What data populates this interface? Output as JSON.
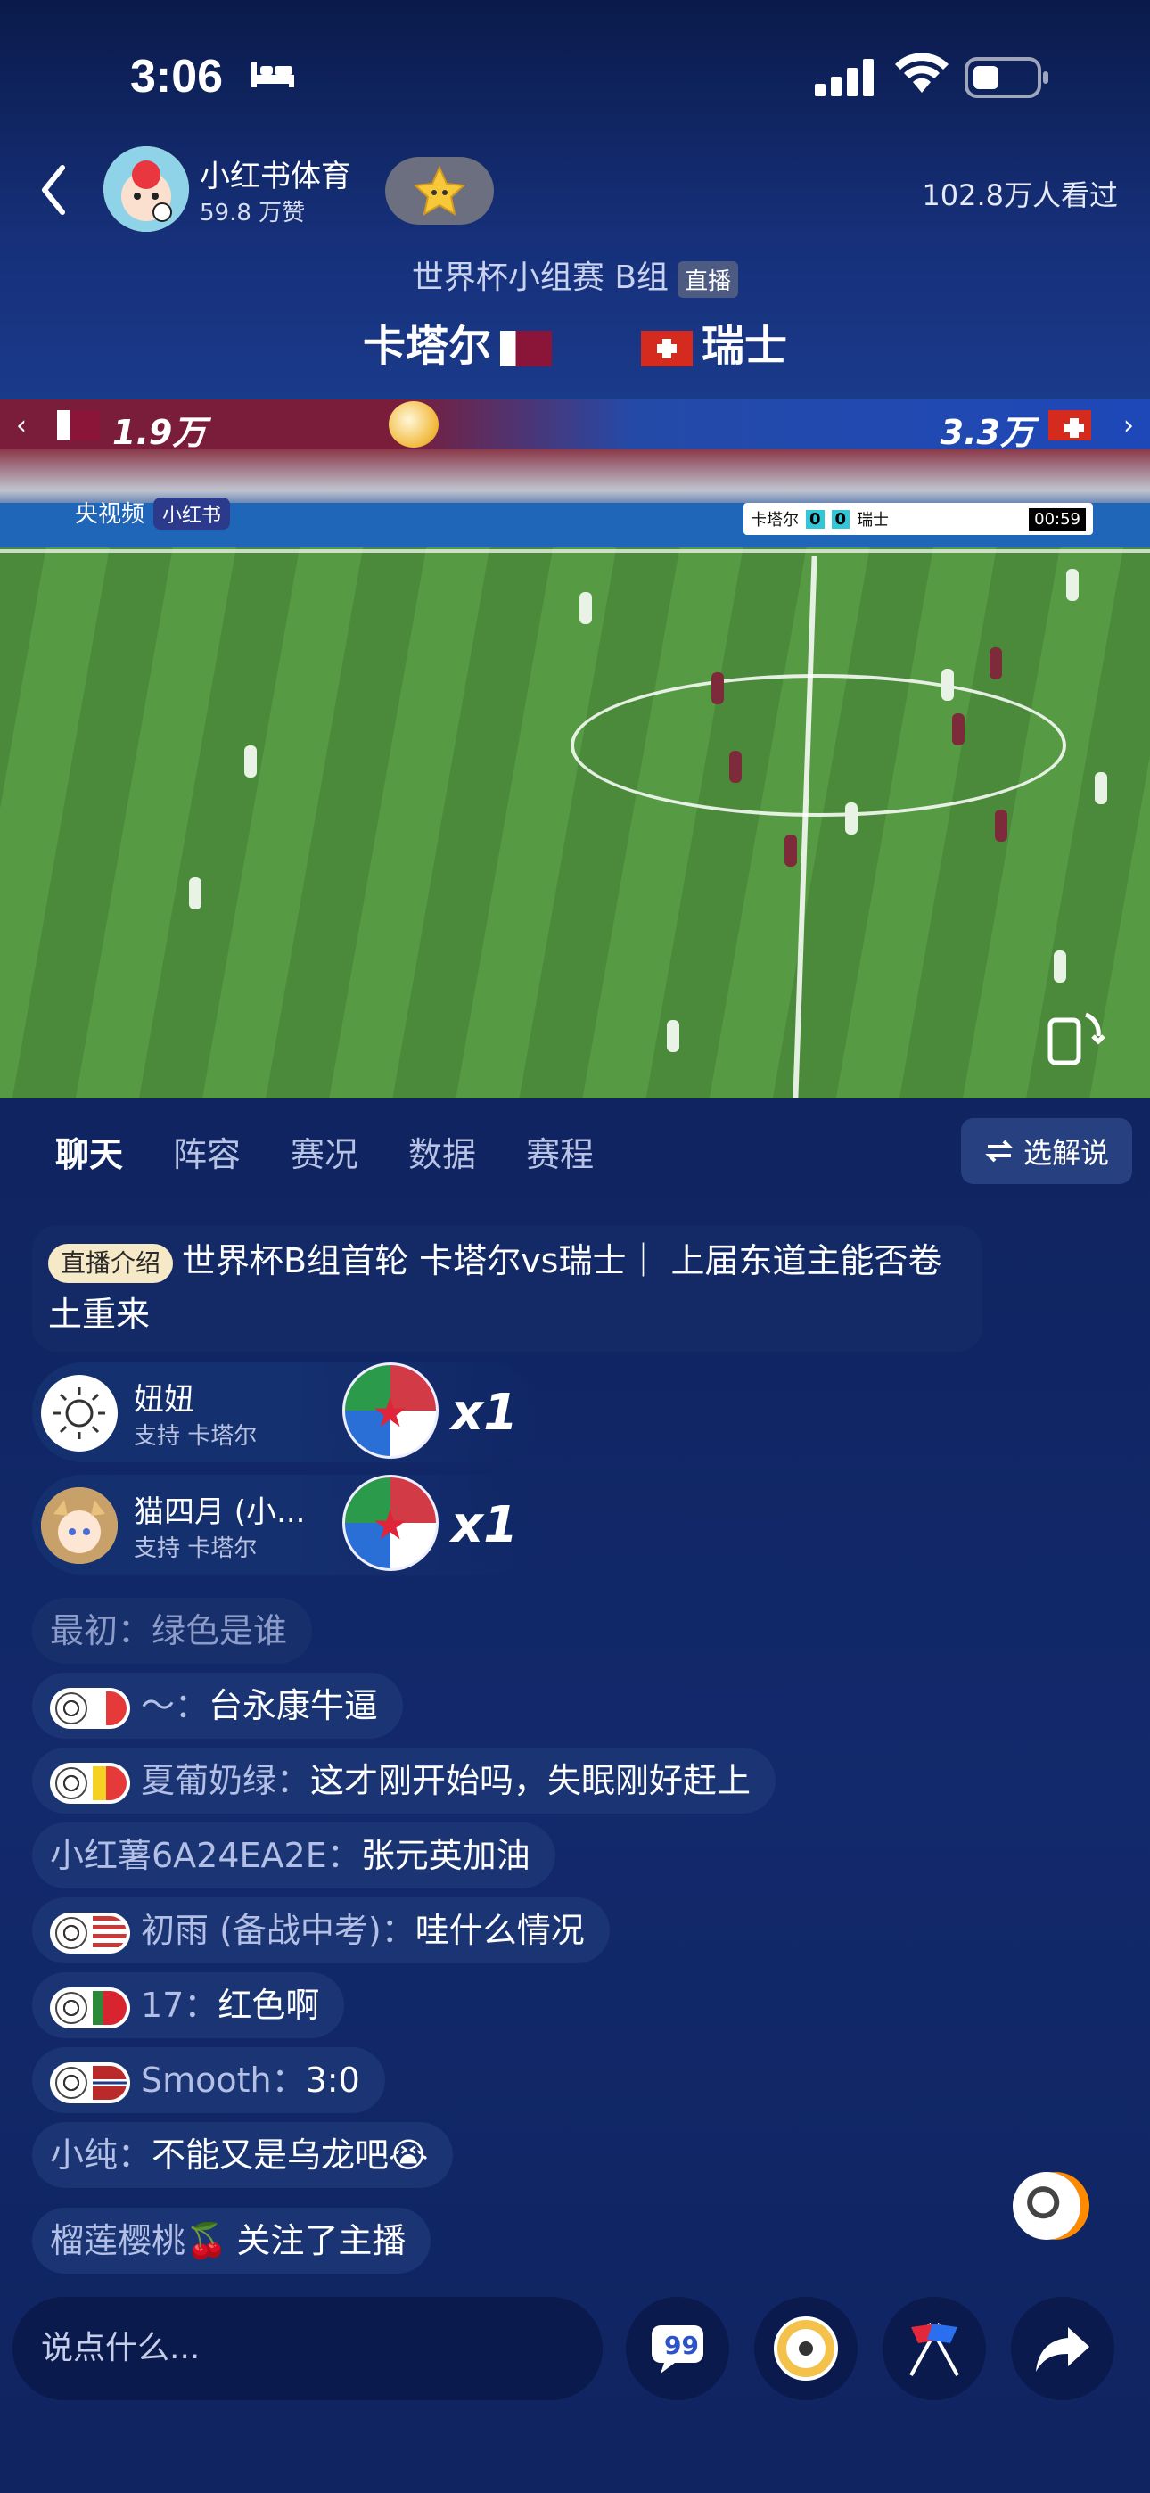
{
  "status_bar": {
    "time": "3:06"
  },
  "header": {
    "channel_name": "小红书体育",
    "likes": "59.8 万赞",
    "viewers": "102.8万人看过",
    "match_title": "世界杯小组赛 B组",
    "live_tag": "直播",
    "home_team": "卡塔尔",
    "away_team": "瑞士"
  },
  "support_bar": {
    "home_count": "1.9万",
    "away_count": "3.3万",
    "home_share": 0.36
  },
  "video": {
    "watermark": "央视频",
    "platform_badge": "小红书",
    "scorebug": {
      "home": "卡塔尔",
      "home_score": "0",
      "away_score": "0",
      "away": "瑞士",
      "clock": "00:59"
    }
  },
  "tabs": [
    "聊天",
    "阵容",
    "赛况",
    "数据",
    "赛程"
  ],
  "commentary_button": "选解说",
  "intro": {
    "tag": "直播介绍",
    "text": "世界杯B组首轮 卡塔尔vs瑞士｜ 上届东道主能否卷土重来"
  },
  "gifts": [
    {
      "name": "妞妞",
      "support": "支持 卡塔尔",
      "count": "x1"
    },
    {
      "name": "猫四月 (小...",
      "support": "支持 卡塔尔",
      "count": "x1"
    }
  ],
  "chat": [
    {
      "user": "最初：",
      "text": "绿色是谁",
      "badge": "",
      "faded": true
    },
    {
      "user": "～：",
      "text": "台永康牛逼",
      "badge": "france"
    },
    {
      "user": "夏葡奶绿：",
      "text": "这才刚开始吗，失眠刚好赶上",
      "badge": "belgium"
    },
    {
      "user": "小红薯6A24EA2E：",
      "text": "张元英加油",
      "badge": ""
    },
    {
      "user": "初雨 (备战中考)：",
      "text": "哇什么情况",
      "badge": "usa"
    },
    {
      "user": "17：",
      "text": "红色啊",
      "badge": "portugal"
    },
    {
      "user": "Smooth：",
      "text": "3:0",
      "badge": "norway"
    },
    {
      "user": "小纯：",
      "text": "不能又是乌龙吧😭",
      "badge": ""
    },
    {
      "user": "榴莲樱桃🍒",
      "text": "关注了主播",
      "badge": ""
    }
  ],
  "input": {
    "placeholder": "说点什么..."
  },
  "colors": {
    "background": "#0d1f54",
    "home_red": "#8a1538",
    "away_red": "#d52b1e"
  }
}
